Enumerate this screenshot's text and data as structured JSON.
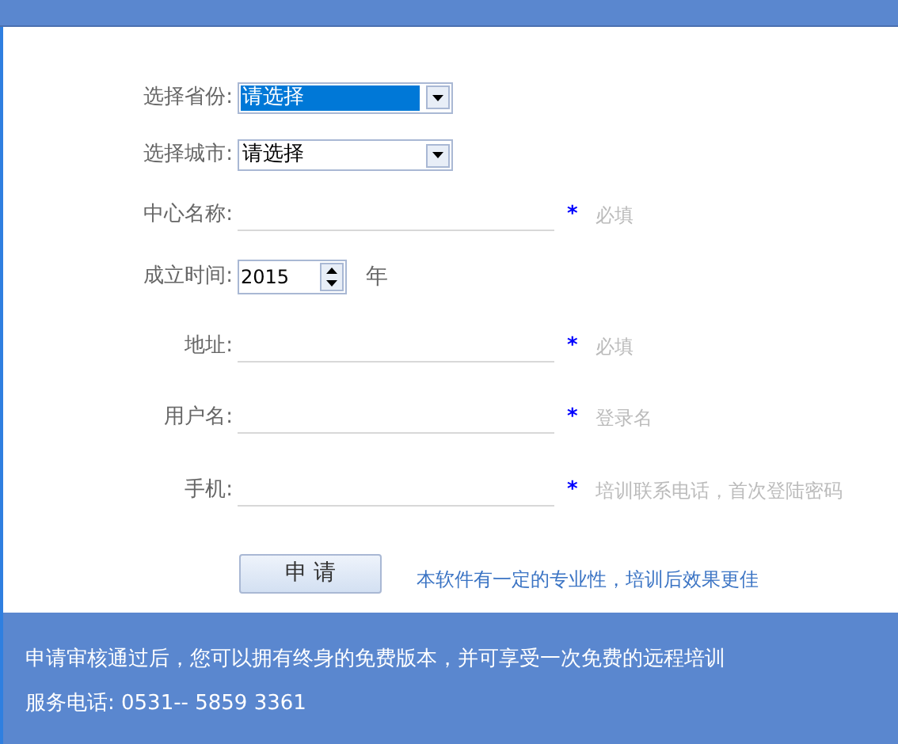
{
  "form": {
    "rows": [
      {
        "kind": "select",
        "label": "选择省份:",
        "value": "请选择",
        "selected": true
      },
      {
        "kind": "select",
        "label": "选择城市:",
        "value": "请选择",
        "selected": false
      },
      {
        "kind": "text",
        "label": "中心名称:",
        "required": "*",
        "hint": "必填"
      },
      {
        "kind": "spin",
        "label": "成立时间:",
        "value": "2015",
        "unit": "年"
      },
      {
        "kind": "text",
        "label": "地址:",
        "required": "*",
        "hint": "必填"
      },
      {
        "kind": "text",
        "label": "用户名:",
        "required": "*",
        "hint": "登录名"
      },
      {
        "kind": "text",
        "label": "手机:",
        "required": "*",
        "hint": "培训联系电话，首次登陆密码"
      }
    ],
    "submit": "申 请",
    "note": "本软件有一定的专业性，培训后效果更佳"
  },
  "footer": {
    "message": "申请审核通过后，您可以拥有终身的免费版本，并可享受一次免费的远程培训",
    "phone": "服务电话: 0531-- 5859 3361"
  }
}
